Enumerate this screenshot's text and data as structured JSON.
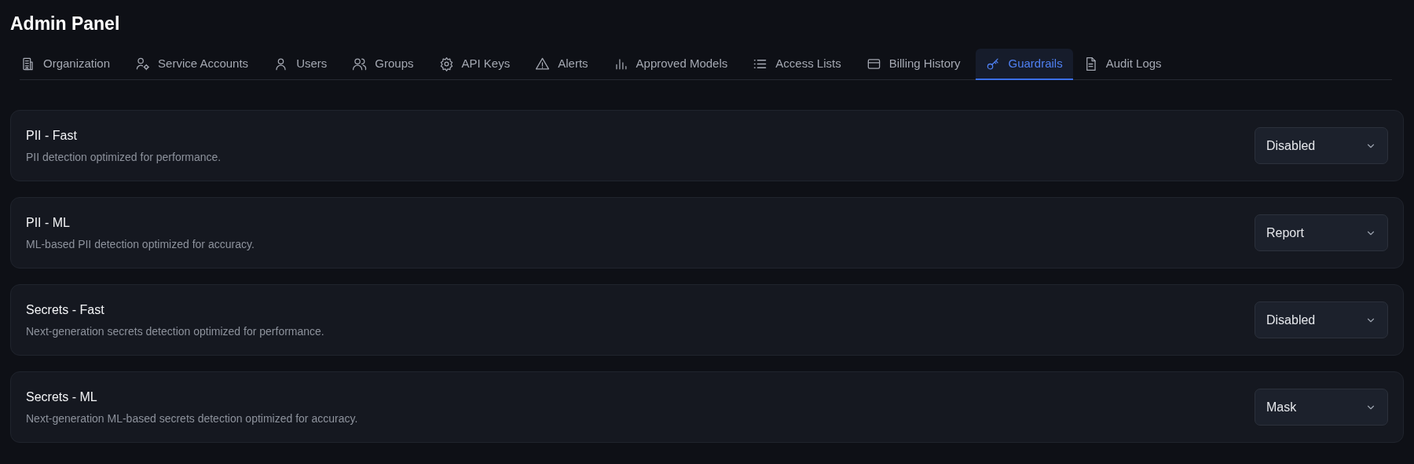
{
  "title": "Admin Panel",
  "tabs": [
    {
      "label": "Organization",
      "kind": "building",
      "selected": false
    },
    {
      "label": "Service Accounts",
      "kind": "usergear",
      "selected": false
    },
    {
      "label": "Users",
      "kind": "user",
      "selected": false
    },
    {
      "label": "Groups",
      "kind": "users",
      "selected": false
    },
    {
      "label": "API Keys",
      "kind": "gear",
      "selected": false
    },
    {
      "label": "Alerts",
      "kind": "warning",
      "selected": false
    },
    {
      "label": "Approved Models",
      "kind": "chart",
      "selected": false
    },
    {
      "label": "Access Lists",
      "kind": "list",
      "selected": false
    },
    {
      "label": "Billing History",
      "kind": "card",
      "selected": false
    },
    {
      "label": "Guardrails",
      "kind": "key",
      "selected": true
    },
    {
      "label": "Audit Logs",
      "kind": "document",
      "selected": false
    }
  ],
  "guardrails": [
    {
      "name": "PII - Fast",
      "description": "PII detection optimized for performance.",
      "mode": "Disabled"
    },
    {
      "name": "PII - ML",
      "description": "ML-based PII detection optimized for accuracy.",
      "mode": "Report"
    },
    {
      "name": "Secrets - Fast",
      "description": "Next-generation secrets detection optimized for performance.",
      "mode": "Disabled"
    },
    {
      "name": "Secrets - ML",
      "description": "Next-generation ML-based secrets detection optimized for accuracy.",
      "mode": "Mask"
    }
  ]
}
